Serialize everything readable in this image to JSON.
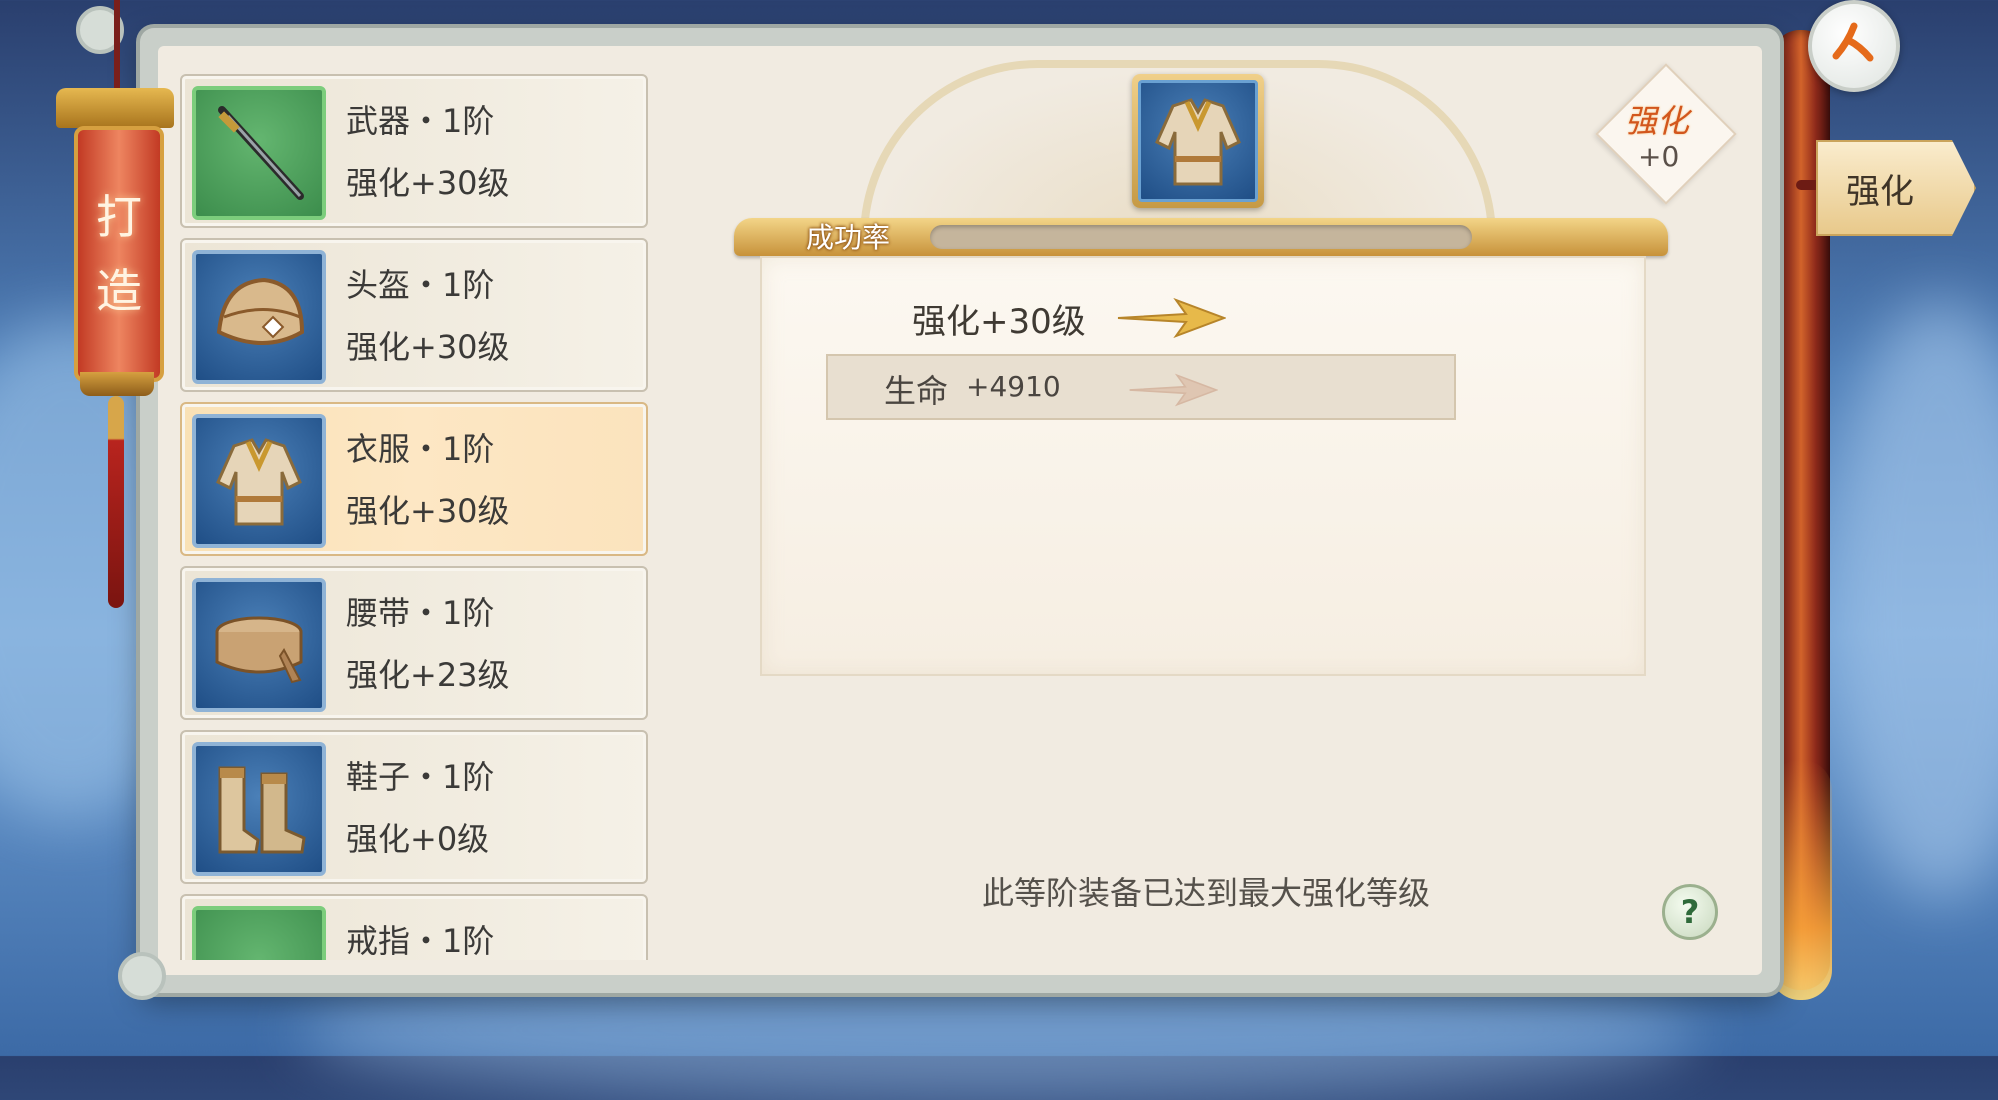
{
  "lantern": {
    "title_line1": "打",
    "title_line2": "造"
  },
  "equipment_list": [
    {
      "name": "武器・1阶",
      "level": "强化+30级",
      "icon": "sword-icon"
    },
    {
      "name": "头盔・1阶",
      "level": "强化+30级",
      "icon": "helmet-icon"
    },
    {
      "name": "衣服・1阶",
      "level": "强化+30级",
      "icon": "armor-icon",
      "selected": true
    },
    {
      "name": "腰带・1阶",
      "level": "强化+23级",
      "icon": "belt-icon"
    },
    {
      "name": "鞋子・1阶",
      "level": "强化+0级",
      "icon": "boots-icon"
    },
    {
      "name": "戒指・1阶",
      "level": "",
      "icon": "ring-icon"
    }
  ],
  "header": {
    "success_label": "成功率",
    "success_rate": 0
  },
  "detail": {
    "level": "强化+30级",
    "stat_label": "生命",
    "stat_value": "+4910"
  },
  "badge": {
    "title": "强化",
    "value": "+0"
  },
  "tab": {
    "label": "强化"
  },
  "message": "此等阶装备已达到最大强化等级",
  "help": {
    "label": "?"
  },
  "colors": {
    "accent_gold": "#e6b850",
    "selected_item": "#fde7c4",
    "lantern_red": "#c23a24",
    "badge_orange": "#d2561d"
  }
}
